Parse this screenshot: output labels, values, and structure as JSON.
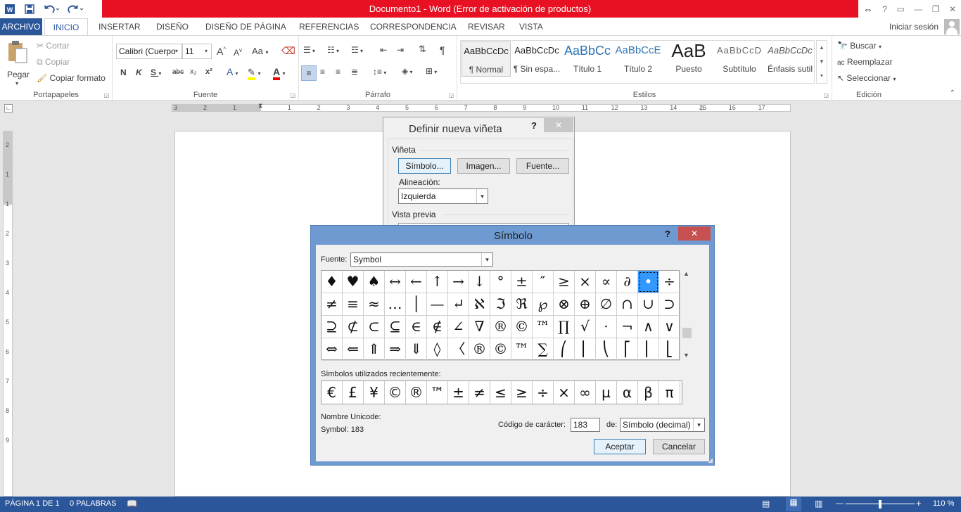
{
  "window": {
    "title": "Documento1 - Word (Error de activación de productos)",
    "sign_in": "Iniciar sesión",
    "help": "?"
  },
  "tabs": [
    {
      "label": "ARCHIVO"
    },
    {
      "label": "INICIO"
    },
    {
      "label": "INSERTAR"
    },
    {
      "label": "DISEÑO"
    },
    {
      "label": "DISEÑO DE PÁGINA"
    },
    {
      "label": "REFERENCIAS"
    },
    {
      "label": "CORRESPONDENCIA"
    },
    {
      "label": "REVISAR"
    },
    {
      "label": "VISTA"
    }
  ],
  "ribbon": {
    "clipboard": {
      "paste": "Pegar",
      "cut": "Cortar",
      "copy": "Copiar",
      "format_painter": "Copiar formato",
      "group_label": "Portapapeles"
    },
    "font": {
      "font_name": "Calibri (Cuerpo",
      "font_size": "11",
      "grow": "A",
      "shrink": "A",
      "case": "Aa",
      "bold": "N",
      "italic": "K",
      "underline": "S",
      "strike": "abc",
      "subscript": "x₂",
      "superscript": "x²",
      "highlight_letter": "A",
      "font_color_letter": "A",
      "group_label": "Fuente"
    },
    "paragraph": {
      "group_label": "Párrafo"
    },
    "styles": {
      "items": [
        {
          "preview": "AaBbCcDc",
          "name": "¶ Normal"
        },
        {
          "preview": "AaBbCcDc",
          "name": "¶ Sin espa..."
        },
        {
          "preview": "AaBbCc",
          "name": "Título 1"
        },
        {
          "preview": "AaBbCcE",
          "name": "Título 2"
        },
        {
          "preview": "AaB",
          "name": "Puesto"
        },
        {
          "preview": "AaBbCcD",
          "name": "Subtítulo"
        },
        {
          "preview": "AaBbCcDc",
          "name": "Énfasis sutil"
        }
      ],
      "group_label": "Estilos"
    },
    "editing": {
      "find": "Buscar",
      "replace": "Reemplazar",
      "select": "Seleccionar",
      "group_label": "Edición"
    }
  },
  "ruler": {
    "h_numbers": [
      "3",
      "2",
      "1",
      "1",
      "2",
      "3",
      "4",
      "5",
      "6",
      "7",
      "8",
      "9",
      "10",
      "11",
      "12",
      "13",
      "14",
      "15",
      "16",
      "17"
    ],
    "v_numbers": [
      "2",
      "1",
      "1",
      "2",
      "3",
      "4",
      "5",
      "6",
      "7",
      "8",
      "9"
    ]
  },
  "bullet_dialog": {
    "title": "Definir nueva viñeta",
    "help": "?",
    "section_bullet": "Viñeta",
    "btn_symbol": "Símbolo...",
    "btn_image": "Imagen...",
    "btn_font": "Fuente...",
    "alignment_label": "Alineación:",
    "alignment_value": "Izquierda",
    "preview_label": "Vista previa"
  },
  "symbol_dialog": {
    "title": "Símbolo",
    "help": "?",
    "font_label": "Fuente:",
    "font_value": "Symbol",
    "grid": [
      "♦",
      "♥",
      "♠",
      "↔",
      "←",
      "↑",
      "→",
      "↓",
      "°",
      "±",
      "″",
      "≥",
      "×",
      "∝",
      "∂",
      "•",
      "÷",
      "≠",
      "≡",
      "≈",
      "…",
      "│",
      "—",
      "↵",
      "ℵ",
      "ℑ",
      "ℜ",
      "℘",
      "⊗",
      "⊕",
      "∅",
      "∩",
      "∪",
      "⊃",
      "⊇",
      "⊄",
      "⊂",
      "⊆",
      "∈",
      "∉",
      "∠",
      "∇",
      "®",
      "©",
      "™",
      "∏",
      "√",
      "⋅",
      "¬",
      "∧",
      "∨",
      "⇔",
      "⇐",
      "⇑",
      "⇒",
      "⇓",
      "◊",
      "〈",
      "®",
      "©",
      "™",
      "∑",
      "⎛",
      "⎜",
      "⎝",
      "⎡",
      "⎢",
      "⎣"
    ],
    "selected_index": 15,
    "recent_label": "Símbolos utilizados recientemente:",
    "recent": [
      "€",
      "£",
      "¥",
      "©",
      "®",
      "™",
      "±",
      "≠",
      "≤",
      "≥",
      "÷",
      "×",
      "∞",
      "µ",
      "α",
      "β",
      "π"
    ],
    "unicode_name_label": "Nombre Unicode:",
    "unicode_name_value": "Symbol: 183",
    "char_code_label": "Código de carácter:",
    "char_code_value": "183",
    "from_label": "de:",
    "from_value": "Símbolo (decimal)",
    "ok": "Aceptar",
    "cancel": "Cancelar"
  },
  "statusbar": {
    "page": "PÁGINA 1 DE 1",
    "words": "0 PALABRAS",
    "zoom": "110 %"
  }
}
